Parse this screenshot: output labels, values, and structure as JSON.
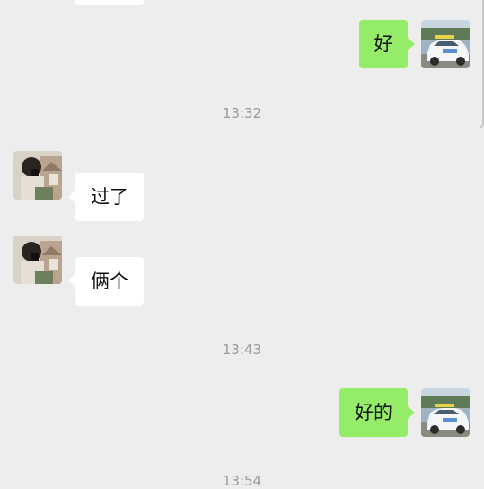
{
  "messages": [
    {
      "side": "in",
      "text": ""
    },
    {
      "side": "out",
      "text": "好"
    },
    {
      "side": "in",
      "text": "过了"
    },
    {
      "side": "in",
      "text": "俩个"
    },
    {
      "side": "out",
      "text": "好的"
    }
  ],
  "timestamps": [
    "13:32",
    "13:43",
    "13:54"
  ],
  "colors": {
    "background": "#ededed",
    "incoming_bubble": "#ffffff",
    "outgoing_bubble": "#95ec69",
    "timestamp_text": "#9a9a9a"
  },
  "icons": {
    "self_avatar": "car-photo-avatar",
    "contact_avatar": "person-photo-avatar"
  }
}
